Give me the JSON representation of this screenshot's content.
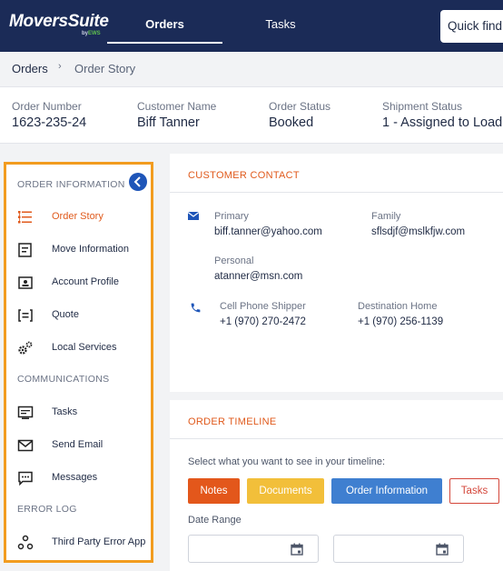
{
  "app": {
    "logo": "MoversSuite",
    "logo_sub_prefix": "by",
    "logo_sub_brand": "EWS"
  },
  "nav": {
    "tabs": [
      {
        "label": "Orders",
        "active": true
      },
      {
        "label": "Tasks",
        "active": false
      }
    ],
    "quick_find_placeholder": "Quick find"
  },
  "breadcrumb": {
    "root": "Orders",
    "separator": "›",
    "current": "Order Story"
  },
  "summary": {
    "fields": [
      {
        "label": "Order Number",
        "value": "1623-235-24"
      },
      {
        "label": "Customer Name",
        "value": "Biff Tanner"
      },
      {
        "label": "Order Status",
        "value": "Booked"
      },
      {
        "label": "Shipment Status",
        "value": "1 - Assigned to Load"
      }
    ]
  },
  "sidebar": {
    "sections": [
      {
        "title": "ORDER INFORMATION"
      },
      {
        "title": "COMMUNICATIONS"
      },
      {
        "title": "ERROR LOG"
      }
    ],
    "items": [
      {
        "label": "Order Story",
        "icon": "order-story-icon",
        "active": true
      },
      {
        "label": "Move Information",
        "icon": "move-info-icon"
      },
      {
        "label": "Account Profile",
        "icon": "account-profile-icon"
      },
      {
        "label": "Quote",
        "icon": "quote-icon"
      },
      {
        "label": "Local Services",
        "icon": "gears-icon"
      },
      {
        "label": "Tasks",
        "icon": "tasks-icon"
      },
      {
        "label": "Send Email",
        "icon": "envelope-icon"
      },
      {
        "label": "Messages",
        "icon": "message-icon"
      },
      {
        "label": "Third Party Error App",
        "icon": "nodes-icon"
      }
    ],
    "colors": {
      "highlight_border": "#f29c1f",
      "active": "#e05a1c"
    }
  },
  "customer_contact": {
    "title": "CUSTOMER CONTACT",
    "emails": [
      {
        "label": "Primary",
        "value": "biff.tanner@yahoo.com"
      },
      {
        "label": "Family",
        "value": "sflsdjf@mslkfjw.com"
      },
      {
        "label": "Personal",
        "value": "atanner@msn.com"
      }
    ],
    "phones": [
      {
        "label": "Cell Phone Shipper",
        "value": "+1 (970) 270-2472"
      },
      {
        "label": "Destination Home",
        "value": "+1 (970) 256-1139"
      }
    ]
  },
  "order_timeline": {
    "title": "ORDER TIMELINE",
    "prompt": "Select what you want to see in your timeline:",
    "filters": [
      {
        "label": "Notes",
        "color": "#e3571b"
      },
      {
        "label": "Documents",
        "color": "#f2bf3a"
      },
      {
        "label": "Order Information",
        "color": "#3f7fd0"
      },
      {
        "label": "Tasks",
        "color": "#d4463a"
      }
    ],
    "date_range_label": "Date Range",
    "date_from": "",
    "date_to": ""
  }
}
